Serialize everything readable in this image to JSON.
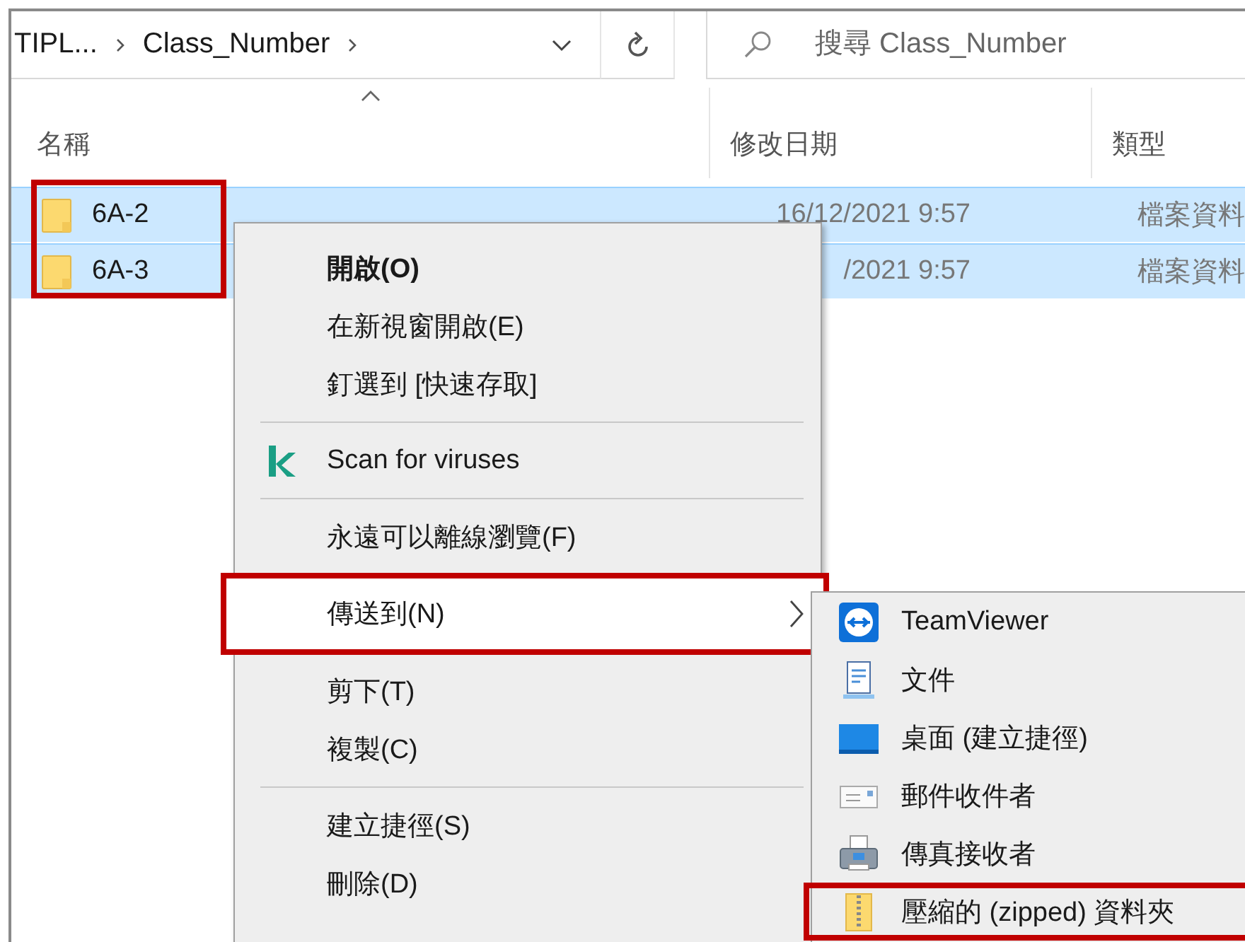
{
  "address_bar": {
    "crumbs": [
      "TIPL...",
      "Class_Number"
    ]
  },
  "search": {
    "placeholder": "搜尋 Class_Number"
  },
  "columns": [
    {
      "label": "名稱",
      "sorted": true
    },
    {
      "label": "修改日期",
      "sorted": false
    },
    {
      "label": "類型",
      "sorted": false
    }
  ],
  "files": {
    "annotated": true,
    "rows": [
      {
        "name": "6A-2",
        "date": "16/12/2021 9:57",
        "type": "檔案資料",
        "selected": true
      },
      {
        "name": "6A-3",
        "date": "/2021 9:57",
        "type": "檔案資料",
        "selected": true
      }
    ]
  },
  "context_menu": [
    {
      "kind": "item",
      "label": "開啟(O)",
      "bold": true,
      "annotated": false
    },
    {
      "kind": "item",
      "label": "在新視窗開啟(E)",
      "bold": false,
      "annotated": false
    },
    {
      "kind": "item",
      "label": "釘選到 [快速存取]",
      "bold": false,
      "annotated": false
    },
    {
      "kind": "separator"
    },
    {
      "kind": "scan",
      "label": "Scan for viruses",
      "bold": false,
      "annotated": false
    },
    {
      "kind": "separator"
    },
    {
      "kind": "item",
      "label": "永遠可以離線瀏覽(F)",
      "bold": false,
      "annotated": false
    },
    {
      "kind": "submenu",
      "label": "傳送到(N)",
      "bold": false,
      "annotated": true,
      "selected": true
    },
    {
      "kind": "item",
      "label": "剪下(T)",
      "bold": false,
      "annotated": false
    },
    {
      "kind": "item",
      "label": "複製(C)",
      "bold": false,
      "annotated": false
    },
    {
      "kind": "separator"
    },
    {
      "kind": "item",
      "label": "建立捷徑(S)",
      "bold": false,
      "annotated": false
    },
    {
      "kind": "item",
      "label": "刪除(D)",
      "bold": false,
      "annotated": false
    }
  ],
  "send_to_menu": [
    {
      "kind": "teamviewer",
      "label": "TeamViewer",
      "annotated": false
    },
    {
      "kind": "document",
      "label": "文件",
      "annotated": false
    },
    {
      "kind": "desktop",
      "label": "桌面 (建立捷徑)",
      "annotated": false
    },
    {
      "kind": "mail",
      "label": "郵件收件者",
      "annotated": false
    },
    {
      "kind": "fax",
      "label": "傳真接收者",
      "annotated": false
    },
    {
      "kind": "zip",
      "label": "壓縮的 (zipped) 資料夾",
      "annotated": true
    }
  ]
}
